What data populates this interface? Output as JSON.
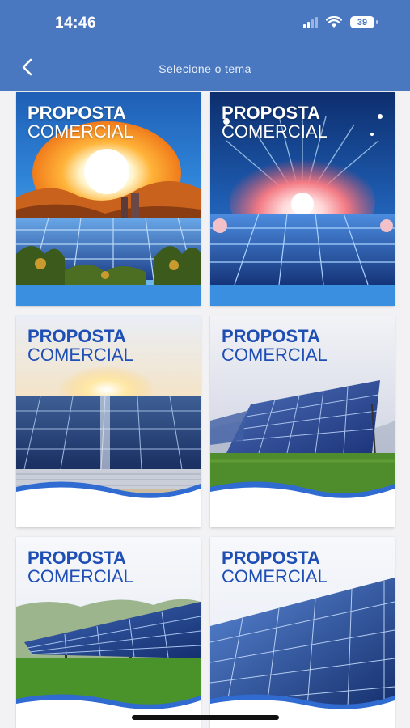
{
  "status": {
    "time": "14:46",
    "battery": "39"
  },
  "header": {
    "title": "Selecione o tema"
  },
  "themes": [
    {
      "title_line1": "PROPOSTA",
      "title_line2": "COMERCIAL"
    },
    {
      "title_line1": "PROPOSTA",
      "title_line2": "COMERCIAL"
    },
    {
      "title_line1": "PROPOSTA",
      "title_line2": "COMERCIAL"
    },
    {
      "title_line1": "PROPOSTA",
      "title_line2": "COMERCIAL"
    },
    {
      "title_line1": "PROPOSTA",
      "title_line2": "COMERCIAL"
    },
    {
      "title_line1": "PROPOSTA",
      "title_line2": "COMERCIAL"
    }
  ],
  "icons": {
    "back": "chevron-left-icon",
    "signal": "cellular-signal-icon",
    "wifi": "wifi-icon",
    "battery": "battery-icon"
  },
  "colors": {
    "header": "#4a78c0",
    "title_blue": "#1f4fb5"
  }
}
